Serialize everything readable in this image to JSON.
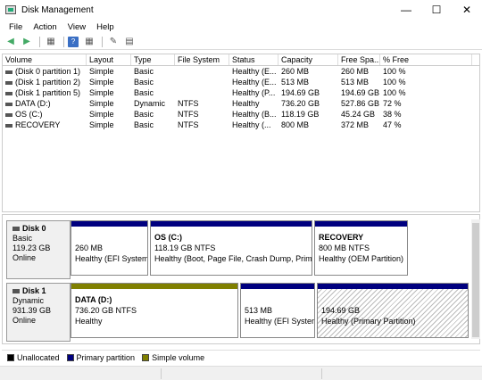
{
  "window": {
    "title": "Disk Management"
  },
  "menu": [
    "File",
    "Action",
    "View",
    "Help"
  ],
  "volume_list": {
    "columns": [
      "Volume",
      "Layout",
      "Type",
      "File System",
      "Status",
      "Capacity",
      "Free Spa...",
      "% Free"
    ],
    "rows": [
      [
        "(Disk 0 partition 1)",
        "Simple",
        "Basic",
        "",
        "Healthy (E...",
        "260 MB",
        "260 MB",
        "100 %"
      ],
      [
        "(Disk 1 partition 2)",
        "Simple",
        "Basic",
        "",
        "Healthy (E...",
        "513 MB",
        "513 MB",
        "100 %"
      ],
      [
        "(Disk 1 partition 5)",
        "Simple",
        "Basic",
        "",
        "Healthy (P...",
        "194.69 GB",
        "194.69 GB",
        "100 %"
      ],
      [
        "DATA (D:)",
        "Simple",
        "Dynamic",
        "NTFS",
        "Healthy",
        "736.20 GB",
        "527.86 GB",
        "72 %"
      ],
      [
        "OS (C:)",
        "Simple",
        "Basic",
        "NTFS",
        "Healthy (B...",
        "118.19 GB",
        "45.24 GB",
        "38 %"
      ],
      [
        "RECOVERY",
        "Simple",
        "Basic",
        "NTFS",
        "Healthy (...",
        "800 MB",
        "372 MB",
        "47 %"
      ]
    ]
  },
  "disks": [
    {
      "name": "Disk 0",
      "type": "Basic",
      "size": "119.23 GB",
      "status": "Online",
      "partitions": [
        {
          "title": "",
          "size": "260 MB",
          "status": "Healthy (EFI System",
          "color": "#00007f"
        },
        {
          "title": "OS  (C:)",
          "size": "118.19 GB NTFS",
          "status": "Healthy (Boot, Page File, Crash Dump, Primary",
          "color": "#00007f"
        },
        {
          "title": "RECOVERY",
          "size": "800 MB NTFS",
          "status": "Healthy (OEM Partition)",
          "color": "#00007f"
        }
      ]
    },
    {
      "name": "Disk 1",
      "type": "Dynamic",
      "size": "931.39 GB",
      "status": "Online",
      "partitions": [
        {
          "title": "DATA  (D:)",
          "size": "736.20 GB NTFS",
          "status": "Healthy",
          "color": "#808000"
        },
        {
          "title": "",
          "size": "513 MB",
          "status": "Healthy (EFI System",
          "color": "#00007f"
        },
        {
          "title": "",
          "size": "194.69 GB",
          "status": "Healthy (Primary Partition)",
          "color": "#00007f"
        }
      ]
    }
  ],
  "legend": [
    {
      "label": "Unallocated",
      "color": "#000000"
    },
    {
      "label": "Primary partition",
      "color": "#00007f"
    },
    {
      "label": "Simple volume",
      "color": "#808000"
    }
  ]
}
